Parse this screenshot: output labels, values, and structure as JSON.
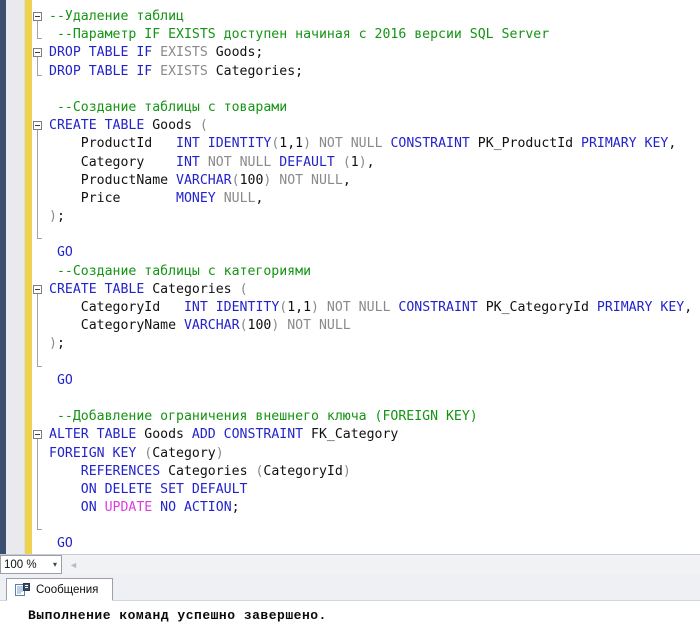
{
  "colors": {
    "keyword": "#2323cc",
    "comment": "#149414",
    "muted": "#8a8a8a",
    "magenta": "#dd3ddd",
    "text": "#111111",
    "change_track_yellow": "#efd24f",
    "margin_navy": "#3c4f6e"
  },
  "editor": {
    "code": {
      "lines": [
        {
          "g": "box",
          "tokens": [
            {
              "c": "cm",
              "t": "--Удаление таблиц"
            }
          ]
        },
        {
          "g": "tick",
          "tokens": [
            {
              "c": "cm",
              "t": " --Параметр IF EXISTS доступен начиная с 2016 версии SQL Server"
            }
          ]
        },
        {
          "g": "box",
          "tokens": [
            {
              "c": "kw",
              "t": "DROP TABLE IF "
            },
            {
              "c": "gr",
              "t": "EXISTS "
            },
            {
              "c": "tx",
              "t": "Goods;"
            }
          ]
        },
        {
          "g": "tick",
          "tokens": [
            {
              "c": "kw",
              "t": "DROP TABLE IF "
            },
            {
              "c": "gr",
              "t": "EXISTS "
            },
            {
              "c": "tx",
              "t": "Categories;"
            }
          ]
        },
        {
          "g": "",
          "tokens": []
        },
        {
          "g": "",
          "tokens": [
            {
              "c": "cm",
              "t": " --Создание таблицы с товарами"
            }
          ]
        },
        {
          "g": "box",
          "tokens": [
            {
              "c": "kw",
              "t": "CREATE TABLE "
            },
            {
              "c": "tx",
              "t": "Goods "
            },
            {
              "c": "gr",
              "t": "("
            }
          ]
        },
        {
          "g": "line",
          "tokens": [
            {
              "c": "tx",
              "t": "    ProductId   "
            },
            {
              "c": "kw",
              "t": "INT IDENTITY"
            },
            {
              "c": "gr",
              "t": "("
            },
            {
              "c": "tx",
              "t": "1,1"
            },
            {
              "c": "gr",
              "t": ") NOT NULL "
            },
            {
              "c": "kw",
              "t": "CONSTRAINT "
            },
            {
              "c": "tx",
              "t": "PK_ProductId "
            },
            {
              "c": "kw",
              "t": "PRIMARY KEY"
            },
            {
              "c": "tx",
              "t": ","
            }
          ]
        },
        {
          "g": "line",
          "tokens": [
            {
              "c": "tx",
              "t": "    Category    "
            },
            {
              "c": "kw",
              "t": "INT "
            },
            {
              "c": "gr",
              "t": "NOT NULL "
            },
            {
              "c": "kw",
              "t": "DEFAULT "
            },
            {
              "c": "gr",
              "t": "("
            },
            {
              "c": "tx",
              "t": "1"
            },
            {
              "c": "gr",
              "t": ")"
            },
            {
              "c": "tx",
              "t": ","
            }
          ]
        },
        {
          "g": "line",
          "tokens": [
            {
              "c": "tx",
              "t": "    ProductName "
            },
            {
              "c": "kw",
              "t": "VARCHAR"
            },
            {
              "c": "gr",
              "t": "("
            },
            {
              "c": "tx",
              "t": "100"
            },
            {
              "c": "gr",
              "t": ") NOT NULL"
            },
            {
              "c": "tx",
              "t": ","
            }
          ]
        },
        {
          "g": "line",
          "tokens": [
            {
              "c": "tx",
              "t": "    Price       "
            },
            {
              "c": "kw",
              "t": "MONEY "
            },
            {
              "c": "gr",
              "t": "NULL"
            },
            {
              "c": "tx",
              "t": ","
            }
          ]
        },
        {
          "g": "line",
          "tokens": [
            {
              "c": "gr",
              "t": ")"
            },
            {
              "c": "tx",
              "t": ";"
            }
          ]
        },
        {
          "g": "tick",
          "tokens": []
        },
        {
          "g": "",
          "tokens": [
            {
              "c": "kw",
              "t": " GO"
            }
          ]
        },
        {
          "g": "",
          "tokens": [
            {
              "c": "cm",
              "t": " --Создание таблицы с категориями"
            }
          ]
        },
        {
          "g": "box",
          "tokens": [
            {
              "c": "kw",
              "t": "CREATE TABLE "
            },
            {
              "c": "tx",
              "t": "Categories "
            },
            {
              "c": "gr",
              "t": "("
            }
          ]
        },
        {
          "g": "line",
          "tokens": [
            {
              "c": "tx",
              "t": "    CategoryId   "
            },
            {
              "c": "kw",
              "t": "INT IDENTITY"
            },
            {
              "c": "gr",
              "t": "("
            },
            {
              "c": "tx",
              "t": "1,1"
            },
            {
              "c": "gr",
              "t": ") NOT NULL "
            },
            {
              "c": "kw",
              "t": "CONSTRAINT "
            },
            {
              "c": "tx",
              "t": "PK_CategoryId "
            },
            {
              "c": "kw",
              "t": "PRIMARY KEY"
            },
            {
              "c": "tx",
              "t": ","
            }
          ]
        },
        {
          "g": "line",
          "tokens": [
            {
              "c": "tx",
              "t": "    CategoryName "
            },
            {
              "c": "kw",
              "t": "VARCHAR"
            },
            {
              "c": "gr",
              "t": "("
            },
            {
              "c": "tx",
              "t": "100"
            },
            {
              "c": "gr",
              "t": ") NOT NULL"
            }
          ]
        },
        {
          "g": "line",
          "tokens": [
            {
              "c": "gr",
              "t": ")"
            },
            {
              "c": "tx",
              "t": ";"
            }
          ]
        },
        {
          "g": "tick",
          "tokens": []
        },
        {
          "g": "",
          "tokens": [
            {
              "c": "kw",
              "t": " GO"
            }
          ]
        },
        {
          "g": "",
          "tokens": []
        },
        {
          "g": "",
          "tokens": [
            {
              "c": "cm",
              "t": " --Добавление ограничения внешнего ключа (FOREIGN KEY)"
            }
          ]
        },
        {
          "g": "box",
          "tokens": [
            {
              "c": "kw",
              "t": "ALTER TABLE "
            },
            {
              "c": "tx",
              "t": "Goods "
            },
            {
              "c": "kw",
              "t": "ADD CONSTRAINT "
            },
            {
              "c": "tx",
              "t": "FK_Category"
            }
          ]
        },
        {
          "g": "line",
          "tokens": [
            {
              "c": "kw",
              "t": "FOREIGN KEY "
            },
            {
              "c": "gr",
              "t": "("
            },
            {
              "c": "tx",
              "t": "Category"
            },
            {
              "c": "gr",
              "t": ")"
            }
          ]
        },
        {
          "g": "line",
          "tokens": [
            {
              "c": "tx",
              "t": "    "
            },
            {
              "c": "kw",
              "t": "REFERENCES "
            },
            {
              "c": "tx",
              "t": "Categories "
            },
            {
              "c": "gr",
              "t": "("
            },
            {
              "c": "tx",
              "t": "CategoryId"
            },
            {
              "c": "gr",
              "t": ")"
            }
          ]
        },
        {
          "g": "line",
          "tokens": [
            {
              "c": "tx",
              "t": "    "
            },
            {
              "c": "kw",
              "t": "ON DELETE SET DEFAULT"
            }
          ]
        },
        {
          "g": "line",
          "tokens": [
            {
              "c": "tx",
              "t": "    "
            },
            {
              "c": "kw",
              "t": "ON "
            },
            {
              "c": "mg",
              "t": "UPDATE "
            },
            {
              "c": "kw",
              "t": "NO ACTION"
            },
            {
              "c": "tx",
              "t": ";"
            }
          ]
        },
        {
          "g": "tick",
          "tokens": []
        },
        {
          "g": "",
          "tokens": [
            {
              "c": "kw",
              "t": " GO"
            }
          ]
        }
      ]
    }
  },
  "statusbar": {
    "zoom_level": "100 %",
    "dropdown_icon": "▾",
    "scroll_left_arrow_icon": "◄"
  },
  "messages": {
    "tab_label": "Сообщения",
    "text": "Выполнение команд успешно завершено."
  }
}
